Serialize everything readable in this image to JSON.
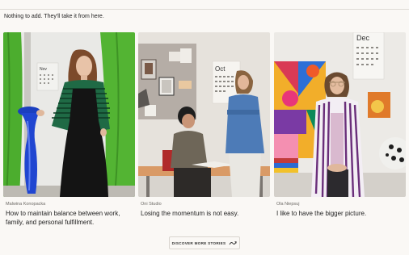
{
  "intro_text": "Nothing to add. They'll take it from here.",
  "stories": [
    {
      "author": "Malwina Konopacka",
      "title": "How to maintain balance between work, family, and personal fulfillment."
    },
    {
      "author": "Oni Studio",
      "title": "Losing the momentum is not easy."
    },
    {
      "author": "Ola Niepsuj",
      "title": "I like to have the bigger picture."
    }
  ],
  "photo_text": {
    "calendar_month_1": "Nov",
    "calendar_month_2": "Oct",
    "calendar_month_3": "Dec"
  },
  "more_button": {
    "label": "DISCOVER MORE STORIES",
    "icon": "loop-arrow-icon"
  },
  "colors": {
    "background": "#faf8f5",
    "text": "#1e1e1e",
    "muted": "#6d6a66"
  }
}
